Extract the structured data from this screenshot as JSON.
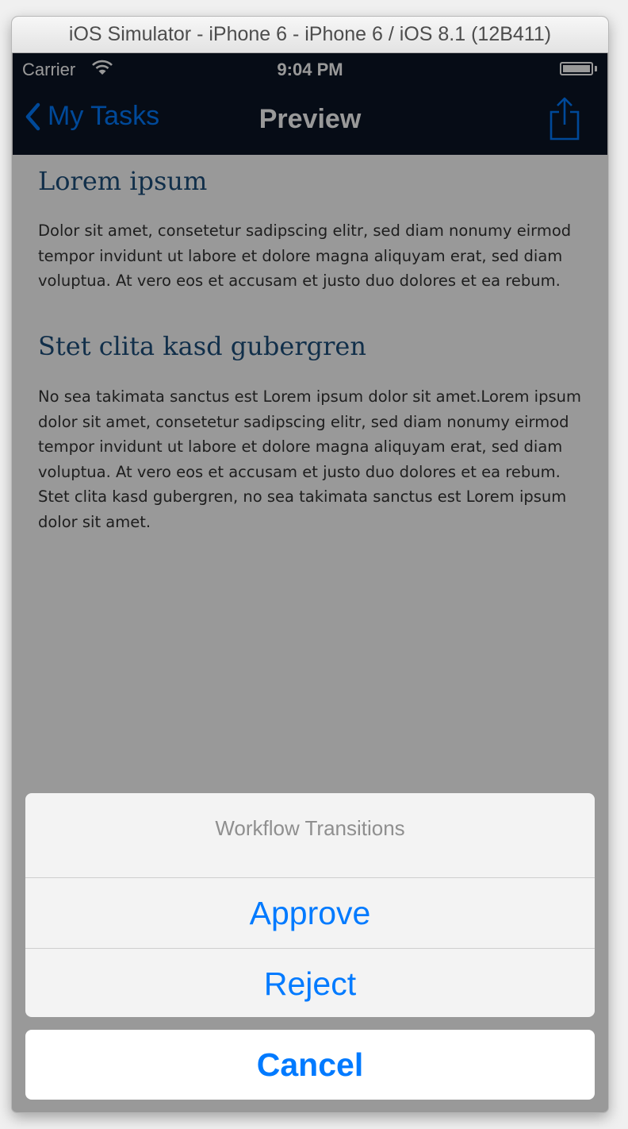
{
  "window": {
    "title": "iOS Simulator - iPhone 6 - iPhone 6 / iOS 8.1 (12B411)"
  },
  "status_bar": {
    "carrier": "Carrier",
    "time": "9:04 PM"
  },
  "nav": {
    "back_label": "My Tasks",
    "title": "Preview"
  },
  "content": {
    "heading1": "Lorem ipsum",
    "paragraph1": "Dolor sit amet, consetetur sadipscing elitr, sed diam nonumy eirmod tempor invidunt ut labore et dolore magna aliquyam erat, sed diam voluptua. At vero eos et accusam et justo duo dolores et ea rebum.",
    "heading2": "Stet clita kasd gubergren",
    "paragraph2": "No sea takimata sanctus est Lorem ipsum dolor sit amet.Lorem ipsum dolor sit amet, consetetur sadipscing elitr, sed diam nonumy eirmod tempor invidunt ut labore et dolore magna aliquyam erat, sed diam voluptua. At vero eos et accusam et justo duo dolores et ea rebum. Stet clita kasd gubergren, no sea takimata sanctus est Lorem ipsum dolor sit amet."
  },
  "action_sheet": {
    "title": "Workflow Transitions",
    "actions": [
      "Approve",
      "Reject"
    ],
    "cancel": "Cancel"
  },
  "colors": {
    "accent": "#007aff",
    "nav_background": "#0b1526",
    "heading": "#1d4f7c",
    "dim_overlay": "rgba(0,0,0,0.4)"
  },
  "icons": [
    "wifi-icon",
    "battery-icon",
    "back-chevron-icon",
    "share-icon"
  ]
}
